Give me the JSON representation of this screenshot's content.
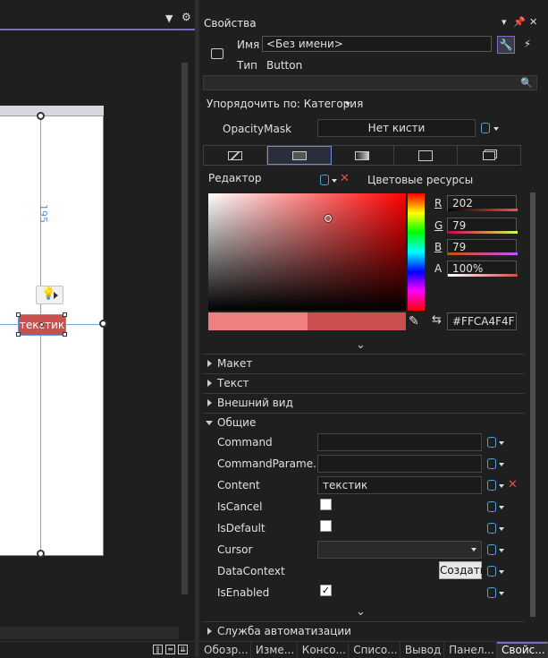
{
  "designer": {
    "dimension_label": "195",
    "button_text": "текстик"
  },
  "properties": {
    "title": "Свойства",
    "name_label": "Имя",
    "name_value": "<Без имени>",
    "type_label": "Тип",
    "type_value": "Button",
    "sort_label": "Упорядочить по: Категория",
    "opacity_mask_label": "OpacityMask",
    "opacity_mask_value": "Нет кисти",
    "editor_label": "Редактор",
    "color_resources_label": "Цветовые ресурсы",
    "channels": {
      "r_label": "R",
      "r_value": "202",
      "g_label": "G",
      "g_value": "79",
      "b_label": "B",
      "b_value": "79",
      "a_label": "A",
      "a_value": "100%"
    },
    "hex_value": "#FFCA4F4F",
    "categories": {
      "layout": "Макет",
      "text": "Текст",
      "appearance": "Внешний вид",
      "common": "Общие",
      "automation": "Служба автоматизации"
    },
    "common_props": {
      "command": "Command",
      "command_parameter": "CommandParame...",
      "content": "Content",
      "content_value": "текстик",
      "is_cancel": "IsCancel",
      "is_default": "IsDefault",
      "cursor": "Cursor",
      "data_context": "DataContext",
      "create_label": "Создать",
      "is_enabled": "IsEnabled"
    }
  },
  "bottom_tabs": [
    "Обозр...",
    "Изме...",
    "Консо...",
    "Списо...",
    "Вывод",
    "Панел...",
    "Свойс..."
  ],
  "colors": {
    "accent": "#7c6cc4",
    "selected_color": "#ca4f4f",
    "previous_color": "#f08080"
  }
}
